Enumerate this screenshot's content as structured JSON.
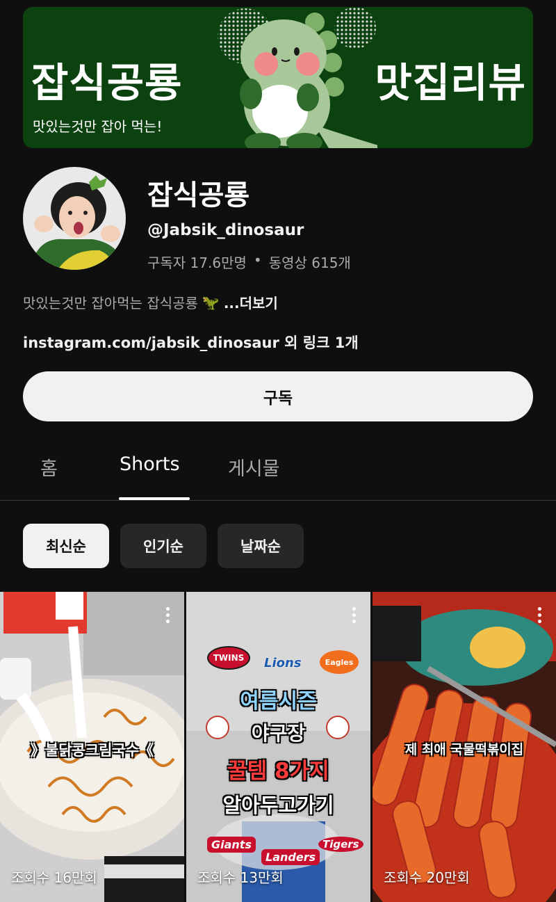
{
  "banner": {
    "title_left": "잡식공룡",
    "subtitle": "맛있는것만 잡아 먹는!",
    "title_right": "맛집리뷰",
    "bg_color": "#0b4210"
  },
  "channel": {
    "name": "잡식공룡",
    "handle": "@Jabsik_dinosaur",
    "subscribers": "구독자 17.6만명",
    "separator": "•",
    "videos": "동영상 615개",
    "description": "맛있는것만 잡아먹는 잡식공룡",
    "description_emoji": "🦖",
    "more": "...더보기",
    "link_text": "instagram.com/jabsik_dinosaur 외 링크 1개"
  },
  "subscribe_label": "구독",
  "tabs": [
    {
      "label": "홈"
    },
    {
      "label": "Shorts"
    },
    {
      "label": "게시물"
    }
  ],
  "chips": [
    {
      "label": "최신순"
    },
    {
      "label": "인기순"
    },
    {
      "label": "날짜순"
    }
  ],
  "shorts": [
    {
      "caption": "》불닭콩크림국수《",
      "views": "조회수 16만회"
    },
    {
      "caption_lines": [
        "여름시즌",
        "야구장",
        "꿀템 8가지",
        "알아두고가기"
      ],
      "logos": [
        "TWINS",
        "Lions",
        "Eagles",
        "Giants",
        "Landers",
        "Tigers"
      ],
      "views": "조회수 13만회"
    },
    {
      "caption": "제 최애 국물떡볶이집",
      "views": "조회수 20만회"
    }
  ]
}
